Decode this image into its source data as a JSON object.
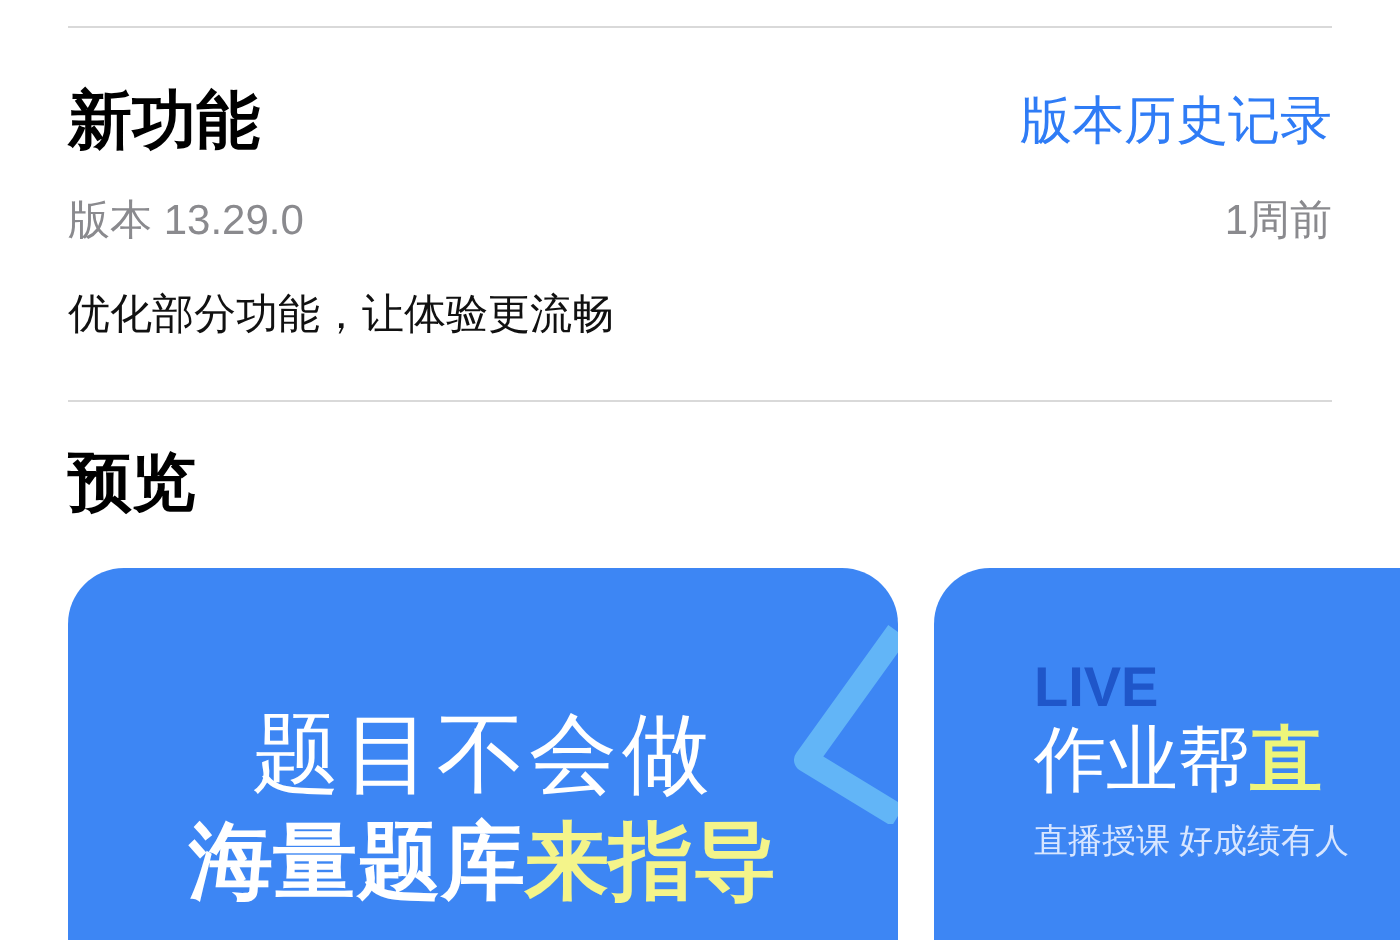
{
  "whats_new": {
    "title": "新功能",
    "history_link": "版本历史记录",
    "version": "版本 13.29.0",
    "time_ago": "1周前",
    "notes": "优化部分功能，让体验更流畅"
  },
  "preview": {
    "title": "预览",
    "screenshots": [
      {
        "kind": "question",
        "line_1": "题目不会做",
        "line_2_plain": "海量题库",
        "line_2_highlight": "来指导"
      },
      {
        "kind": "live",
        "watermark": "LIVE",
        "headline_plain": "作业帮",
        "headline_highlight": "直",
        "subtitle": "直播授课 好成绩有人"
      }
    ]
  }
}
